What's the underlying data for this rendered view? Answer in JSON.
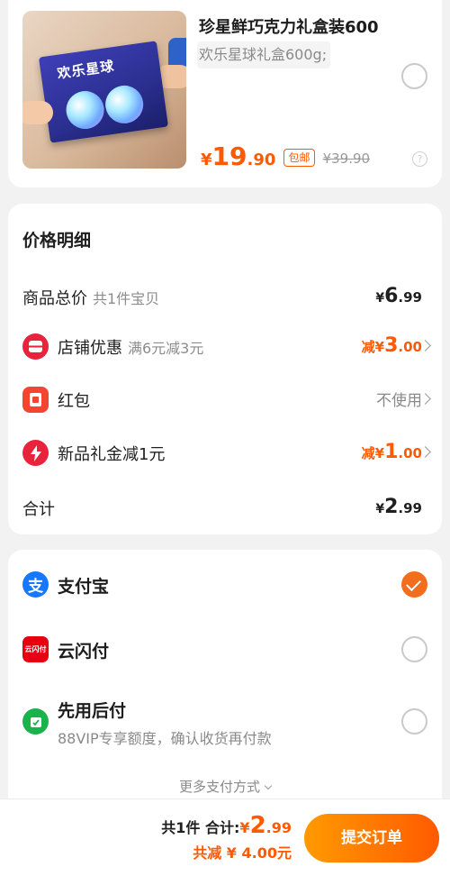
{
  "product": {
    "title": "珍星鲜巧克力礼盒装600",
    "sku": "欢乐星球礼盒600g;",
    "image_text": "欢乐星球",
    "price_symbol": "¥",
    "price_int": "19",
    "price_dec": ".90",
    "shipping_badge": "包邮",
    "original_price": "¥39.90",
    "selected": false
  },
  "price_detail": {
    "title": "价格明细",
    "rows": [
      {
        "label": "商品总价",
        "sub": "共1件宝贝",
        "sym": "¥",
        "int": "6",
        "dec": ".99"
      },
      {
        "label": "店铺优惠",
        "sub": "满6元减3元",
        "prefix": "减",
        "sym": "¥",
        "int": "3",
        "dec": ".00"
      },
      {
        "label": "红包",
        "value_text": "不使用"
      },
      {
        "label": "新品礼金减1元",
        "prefix": "减",
        "sym": "¥",
        "int": "1",
        "dec": ".00"
      },
      {
        "label": "合计",
        "sym": "¥",
        "int": "2",
        "dec": ".99"
      }
    ]
  },
  "payment": {
    "methods": [
      {
        "label": "支付宝",
        "icon": "alipay-icon",
        "color": "#1677ff",
        "selected": true
      },
      {
        "label": "云闪付",
        "icon": "unionpay-quickpass-icon",
        "color": "#e60012",
        "selected": false
      },
      {
        "label": "先用后付",
        "sub": "88VIP专享额度，确认收货再付款",
        "icon": "pay-later-icon",
        "color": "#19b24b",
        "selected": false
      }
    ],
    "more_label": "更多支付方式"
  },
  "bottom_bar": {
    "count": "共1件",
    "total_label": "合计:",
    "sym": "¥",
    "int": "2",
    "dec": ".99",
    "saved": "共减 ¥ 4.00元",
    "submit_label": "提交订单"
  },
  "colors": {
    "accent": "#ff5a00",
    "background": "#f2f2f2"
  }
}
